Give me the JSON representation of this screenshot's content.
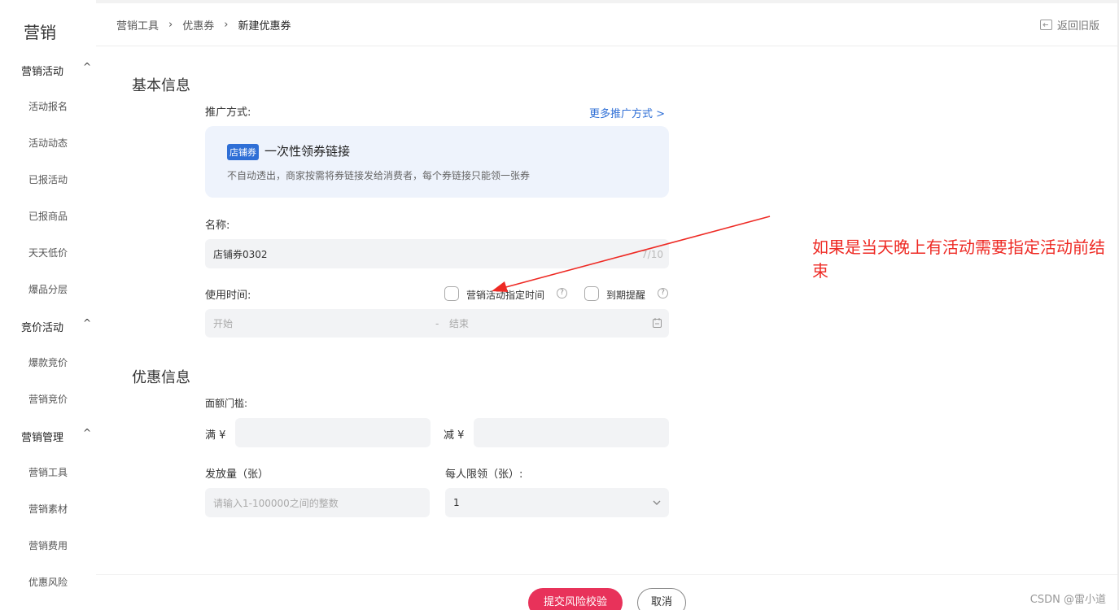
{
  "sidebar": {
    "title": "营销",
    "groups": [
      {
        "label": "营销活动",
        "items": [
          "活动报名",
          "活动动态",
          "已报活动",
          "已报商品",
          "天天低价",
          "爆品分层"
        ]
      },
      {
        "label": "竞价活动",
        "items": [
          "爆款竞价",
          "营销竞价"
        ]
      },
      {
        "label": "营销管理",
        "items": [
          "营销工具",
          "营销素材",
          "营销费用",
          "优惠风险"
        ]
      }
    ],
    "chevron": "^"
  },
  "breadcrumb": [
    "营销工具",
    "优惠券",
    "新建优惠券"
  ],
  "breadcrumb_sep": "›",
  "back_label": "返回旧版",
  "basic": {
    "title": "基本信息",
    "promo_label": "推广方式:",
    "more_link": "更多推广方式 >",
    "promo_tag": "店铺券",
    "promo_name": "一次性领券链接",
    "promo_desc": "不自动透出，商家按需将券链接发给消费者，每个券链接只能领一张券",
    "name_label": "名称:",
    "name_value": "店铺券0302",
    "name_counter": "7/10",
    "time_label": "使用时间:",
    "cb1_label": "营销活动指定时间",
    "cb2_label": "到期提醒",
    "help_glyph": "?",
    "start_placeholder": "开始",
    "range_sep": "-",
    "end_placeholder": "结束"
  },
  "discount": {
    "title": "优惠信息",
    "threshold_label": "面额门槛:",
    "full_label": "满 ¥",
    "minus_label": "减 ¥",
    "qty_label": "发放量（张）",
    "qty_placeholder": "请输入1-100000之间的整数",
    "limit_label": "每人限领（张）:",
    "limit_value": "1"
  },
  "annotation": "如果是当天晚上有活动需要指定活动前结束",
  "annotation_color": "#ee2a24",
  "actions": {
    "submit": "提交风险校验",
    "cancel": "取消"
  },
  "watermark": "CSDN @雷小道",
  "colors": {
    "accent": "#2f6fd6",
    "primary_button": "#e8325a"
  }
}
